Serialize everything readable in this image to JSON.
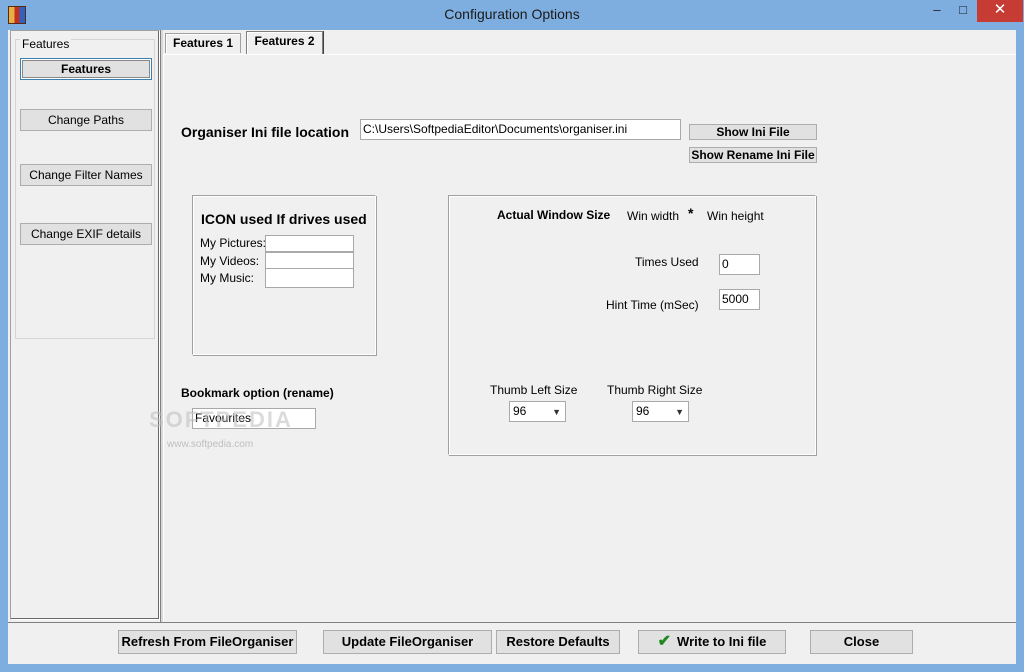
{
  "window": {
    "title": "Configuration Options",
    "minimize": "‒",
    "maximize": "□",
    "close": "✕"
  },
  "sidebar": {
    "group_label": "Features",
    "items": [
      {
        "label": "Features",
        "active": true
      },
      {
        "label": "Change Paths"
      },
      {
        "label": "Change Filter Names"
      },
      {
        "label": "Change EXIF details"
      }
    ]
  },
  "tabs": [
    {
      "label": "Features 1"
    },
    {
      "label": "Features 2",
      "active": true
    }
  ],
  "ini": {
    "label": "Organiser Ini file location",
    "value": "C:\\Users\\SoftpediaEditor\\Documents\\organiser.ini",
    "show_btn": "Show Ini File",
    "show_rename_btn": "Show Rename Ini File"
  },
  "icons_group": {
    "title": "ICON used If drives used",
    "pictures_label": "My Pictures:",
    "videos_label": "My Videos:",
    "music_label": "My Music:",
    "pictures_value": "",
    "videos_value": "",
    "music_value": ""
  },
  "bookmark": {
    "label": "Bookmark option (rename)",
    "value": "Favourites"
  },
  "window_size": {
    "title": "Actual Window Size",
    "win_width_label": "Win width",
    "star": "*",
    "win_height_label": "Win height",
    "times_used_label": "Times Used",
    "times_used_value": "0",
    "hint_time_label": "Hint Time (mSec)",
    "hint_time_value": "5000",
    "thumb_left_label": "Thumb Left Size",
    "thumb_left_value": "96",
    "thumb_right_label": "Thumb Right Size",
    "thumb_right_value": "96"
  },
  "footer": {
    "refresh": "Refresh From FileOrganiser",
    "update": "Update FileOrganiser",
    "restore": "Restore Defaults",
    "write": "Write to Ini file",
    "close": "Close"
  },
  "watermark": {
    "text": "SOFTPEDIA",
    "url": "www.softpedia.com"
  }
}
